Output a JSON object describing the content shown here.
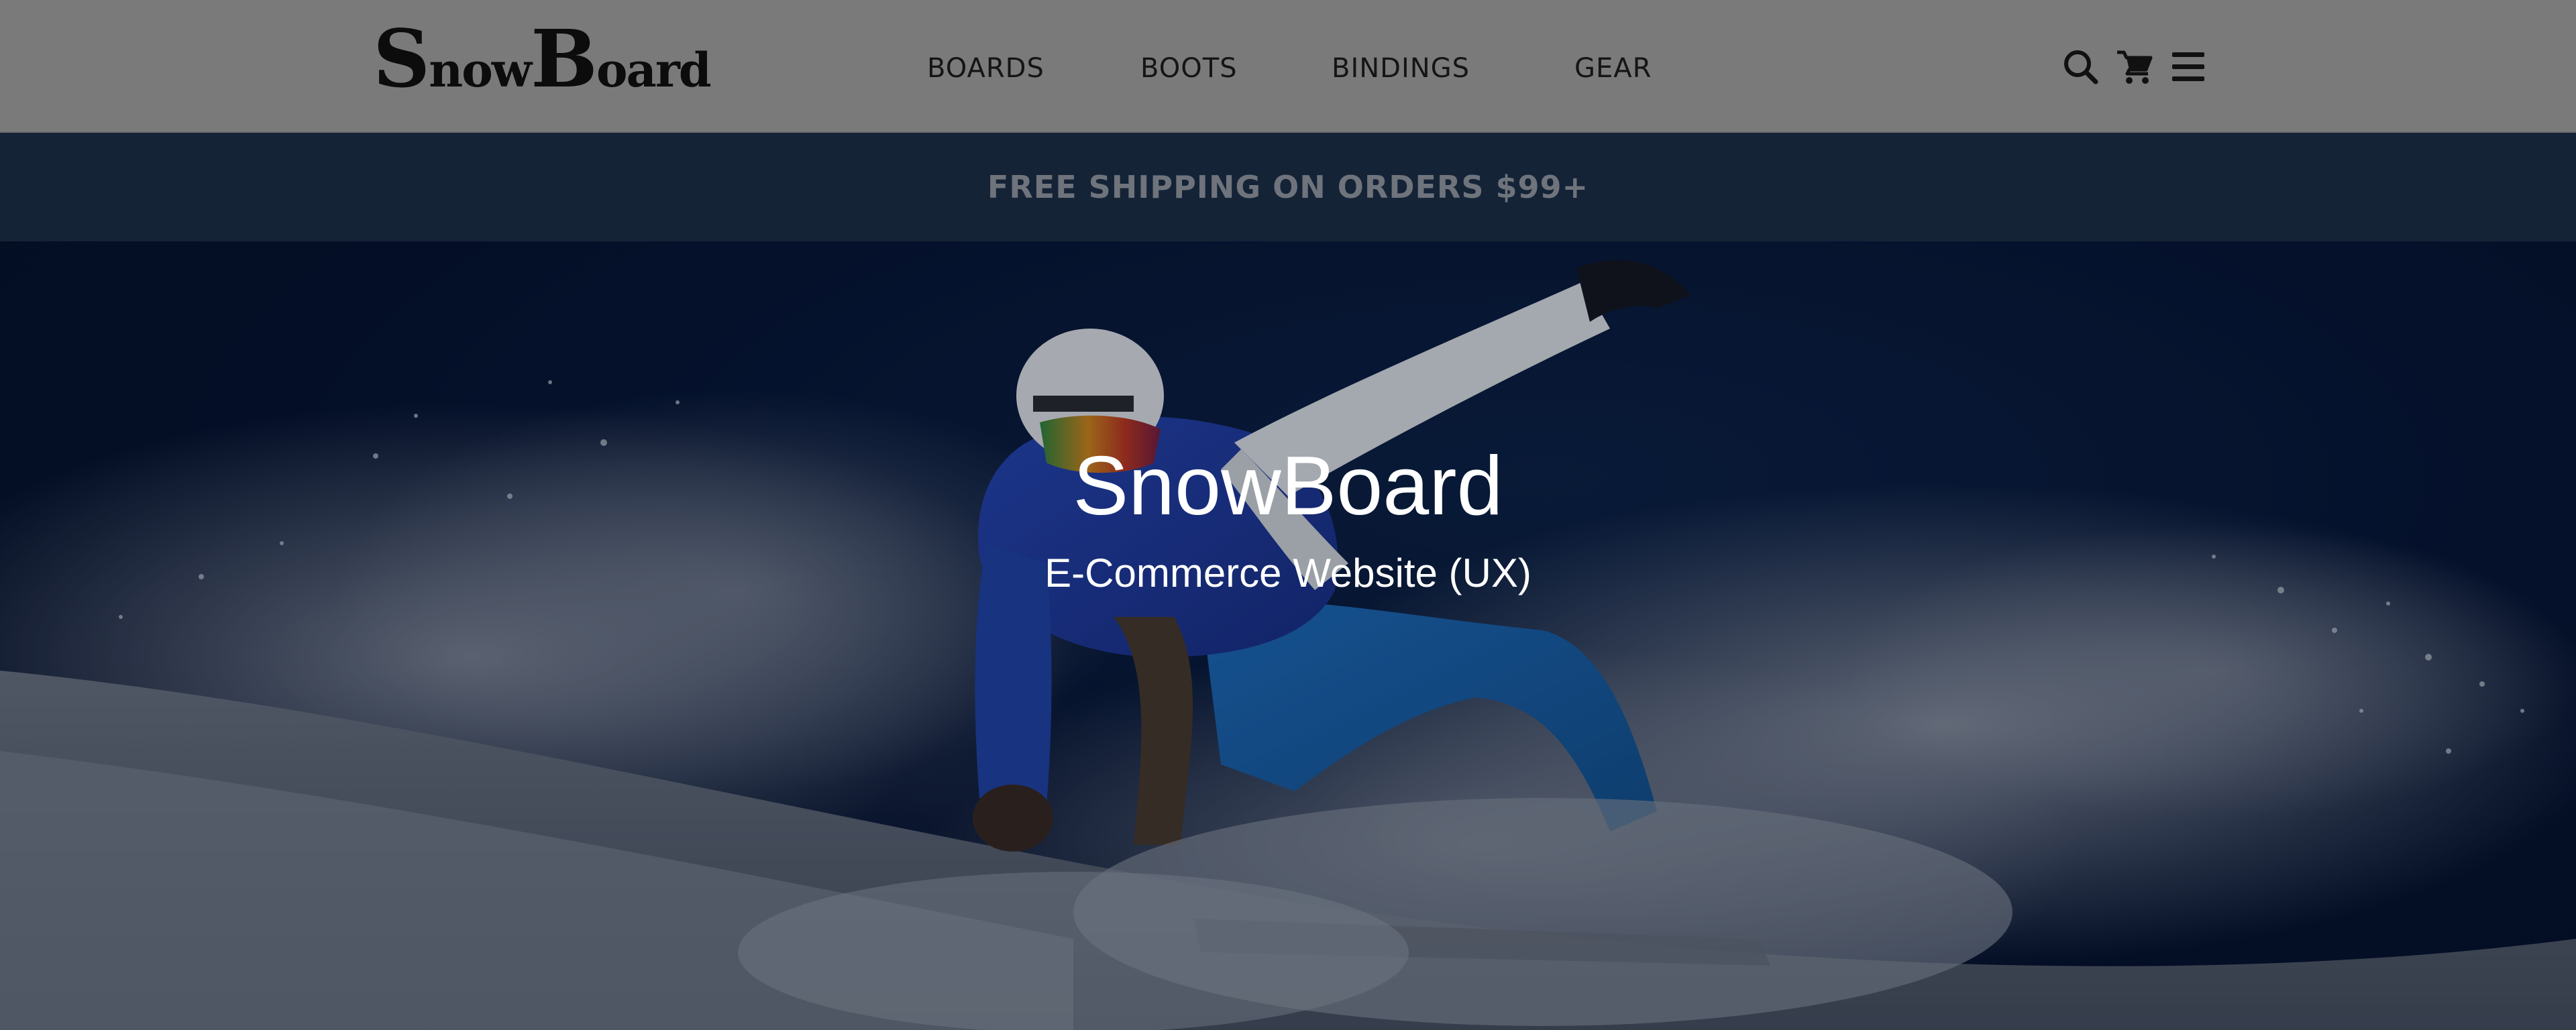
{
  "brand": {
    "logo_text": "SnowBoard"
  },
  "nav": {
    "items": [
      {
        "label": "BOARDS"
      },
      {
        "label": "BOOTS"
      },
      {
        "label": "BINDINGS"
      },
      {
        "label": "GEAR"
      }
    ]
  },
  "header_icons": [
    "search-icon",
    "cart-icon",
    "menu-icon"
  ],
  "banner": {
    "text": "FREE SHIPPING ON ORDERS $99+"
  },
  "hero": {
    "title": "SnowBoard",
    "subtitle": "E-Commerce Website (UX)"
  },
  "colors": {
    "header_bg": "#7a7a7a",
    "banner_bg": "#152337",
    "banner_text": "#6f747c",
    "hero_sky": "#071533",
    "hero_text": "#ffffff"
  }
}
